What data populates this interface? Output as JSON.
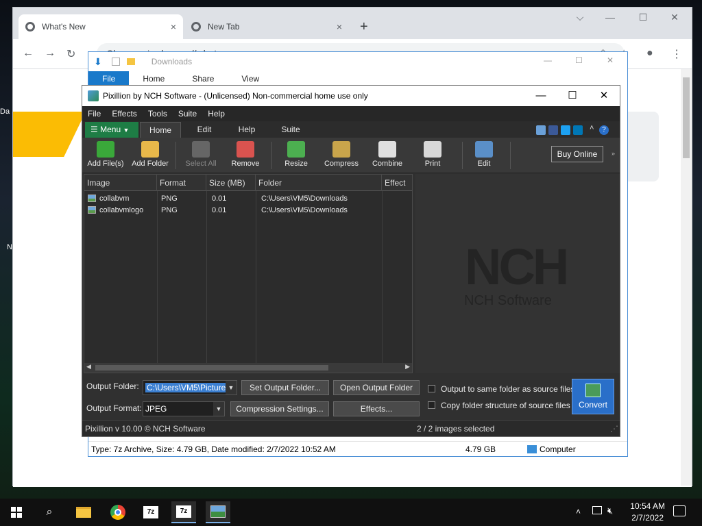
{
  "desktop": {
    "fragments": [
      "Da",
      "N"
    ]
  },
  "chrome": {
    "tabs": [
      {
        "label": "What's New",
        "close": "×"
      },
      {
        "label": "New Tab",
        "close": "×"
      }
    ],
    "new_tab": "+",
    "address": "chrome://whats-new",
    "address_scheme": "Chrome"
  },
  "explorer": {
    "title": "Downloads",
    "ribbon_tabs": [
      "File",
      "Home",
      "Share",
      "View"
    ],
    "status_info": "Type: 7z Archive, Size: 4.79 GB, Date modified: 2/7/2022 10:52 AM",
    "status_size": "4.79 GB",
    "status_location": "Computer"
  },
  "pixillion": {
    "title": "Pixillion by NCH Software - (Unlicensed) Non-commercial home use only",
    "menubar": [
      "File",
      "Effects",
      "Tools",
      "Suite",
      "Help"
    ],
    "menu_button": "Menu",
    "tabs": [
      "Home",
      "Edit",
      "Help",
      "Suite"
    ],
    "toolbar": {
      "add_files": "Add File(s)",
      "add_folder": "Add Folder",
      "select_all": "Select All",
      "remove": "Remove",
      "resize": "Resize",
      "compress": "Compress",
      "combine": "Combine",
      "print": "Print",
      "edit": "Edit",
      "buy_online": "Buy Online"
    },
    "columns": [
      "Image",
      "Format",
      "Size (MB)",
      "Folder",
      "Effect"
    ],
    "files": [
      {
        "name": "collabvm",
        "format": "PNG",
        "size": "0.01",
        "folder": "C:\\Users\\VM5\\Downloads"
      },
      {
        "name": "collabvmlogo",
        "format": "PNG",
        "size": "0.01",
        "folder": "C:\\Users\\VM5\\Downloads"
      }
    ],
    "preview_logo": "NCH",
    "preview_name": "NCH Software",
    "output_folder_label": "Output Folder:",
    "output_folder_value": "C:\\Users\\VM5\\Pictures",
    "set_output_folder": "Set Output Folder...",
    "open_output_folder": "Open Output Folder",
    "output_format_label": "Output Format:",
    "output_format_value": "JPEG",
    "compression_settings": "Compression Settings...",
    "effects": "Effects...",
    "chk_same_folder": "Output to same folder as source files",
    "chk_copy_structure": "Copy folder structure of source files",
    "convert": "Convert",
    "version": "Pixillion v 10.00 © NCH Software",
    "selection_status": "2 / 2 images selected"
  },
  "taskbar": {
    "time": "10:54 AM",
    "date": "2/7/2022",
    "icons": [
      "windows-start-icon",
      "search-icon",
      "file-explorer-icon",
      "chrome-icon",
      "7zip-icon",
      "7zip-active-icon",
      "pixillion-icon"
    ]
  },
  "colors": {
    "accent_green": "#1e7d45",
    "convert_blue": "#2a6fc9",
    "selection_blue": "#3b7fd1",
    "taskbar_bg": "#101010"
  }
}
